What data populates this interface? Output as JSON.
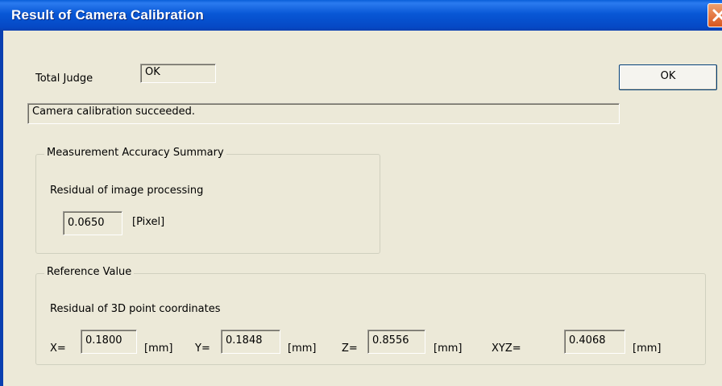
{
  "window": {
    "title": "Result of Camera Calibration"
  },
  "total_judge": {
    "label": "Total Judge",
    "value": "OK"
  },
  "ok_button": {
    "label": "OK"
  },
  "message": "Camera calibration succeeded.",
  "accuracy_summary": {
    "legend": "Measurement Accuracy Summary",
    "caption": "Residual of image processing",
    "value": "0.0650",
    "unit": "[Pixel]"
  },
  "reference": {
    "legend": "Reference Value",
    "caption": "Residual of 3D point coordinates",
    "x": {
      "label": "X=",
      "value": "0.1800",
      "unit": "[mm]"
    },
    "y": {
      "label": "Y=",
      "value": "0.1848",
      "unit": "[mm]"
    },
    "z": {
      "label": "Z=",
      "value": "0.8556",
      "unit": "[mm]"
    },
    "xyz": {
      "label": "XYZ=",
      "value": "0.4068",
      "unit": "[mm]"
    }
  },
  "colors": {
    "title_bar": "#0a5fd8",
    "dialog_background": "#ece9d8",
    "close_button": "#d9561e"
  }
}
